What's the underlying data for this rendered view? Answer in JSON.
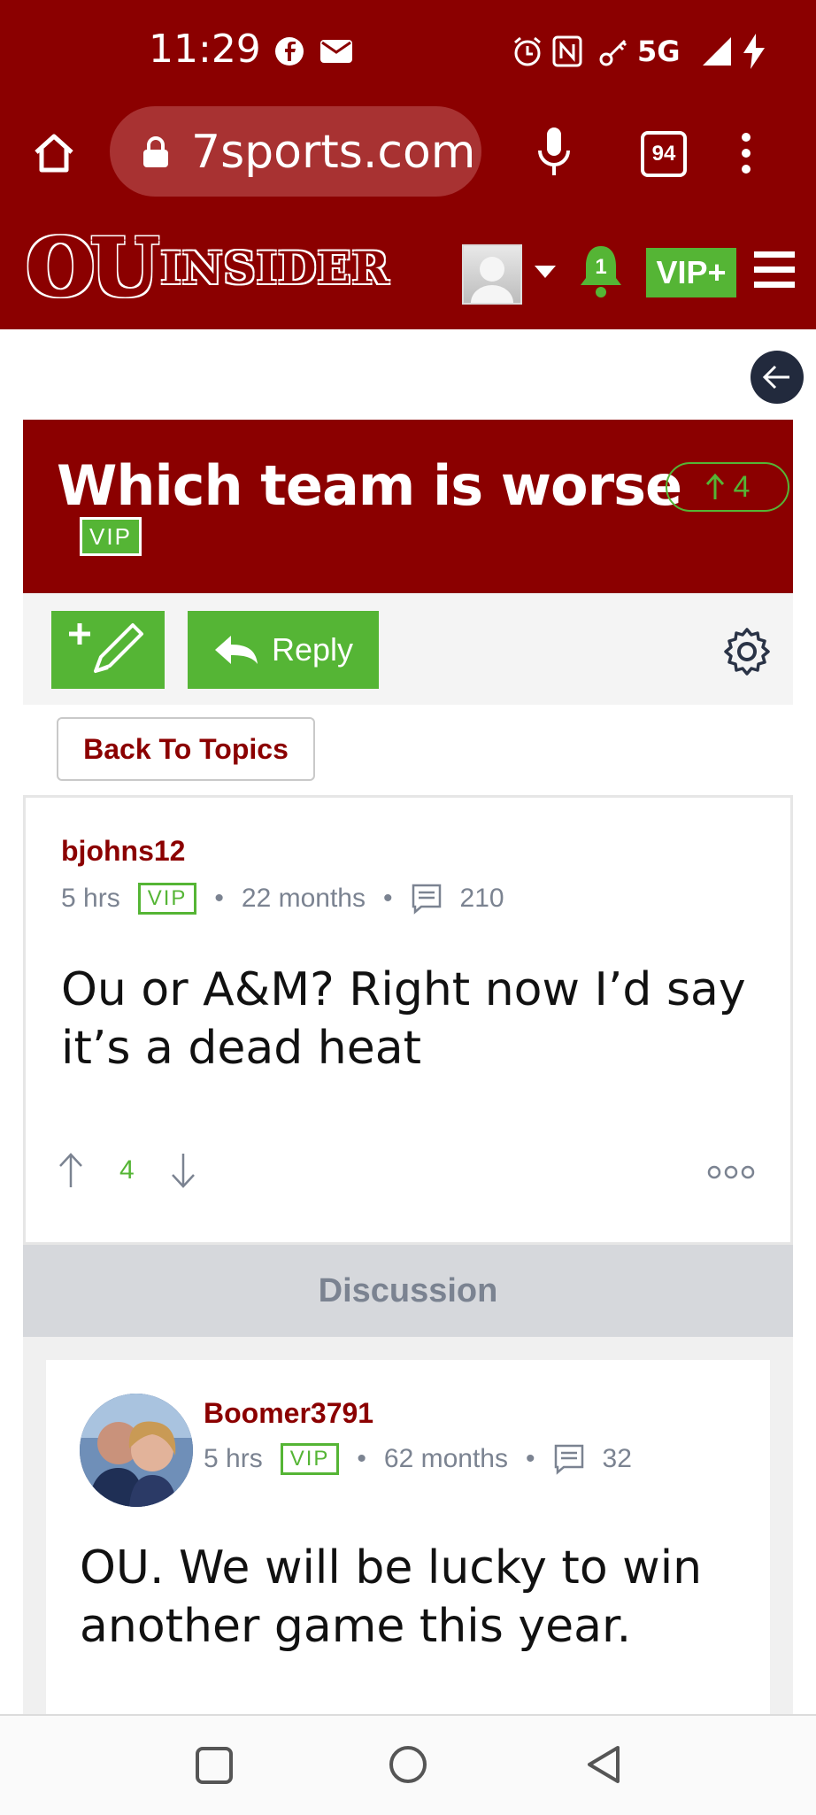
{
  "status_bar": {
    "time": "11:29",
    "network": "5G"
  },
  "browser": {
    "url": "7sports.com",
    "tab_count": "94"
  },
  "site": {
    "logo_ou": "OU",
    "logo_insider": "INSIDER",
    "notification_count": "1",
    "vip_plus_label": "VIP+"
  },
  "topic": {
    "title": "Which team is worse",
    "vote_count": "4",
    "vip_label": "VIP"
  },
  "toolbar": {
    "reply_label": "Reply"
  },
  "back_to_topics": "Back To Topics",
  "post": {
    "author": "bjohns12",
    "age": "5 hrs",
    "vip_label": "VIP",
    "member_duration": "22 months",
    "post_count": "210",
    "body": "Ou or A&M? Right now I’d say it’s a dead heat",
    "score": "4"
  },
  "discussion_label": "Discussion",
  "reply": {
    "author": "Boomer3791",
    "age": "5 hrs",
    "vip_label": "VIP",
    "member_duration": "62 months",
    "post_count": "32",
    "body": "OU. We will be lucky to win another game this year."
  },
  "colors": {
    "brand": "#8b0000",
    "accent": "#55b535",
    "muted": "#7b8391"
  }
}
